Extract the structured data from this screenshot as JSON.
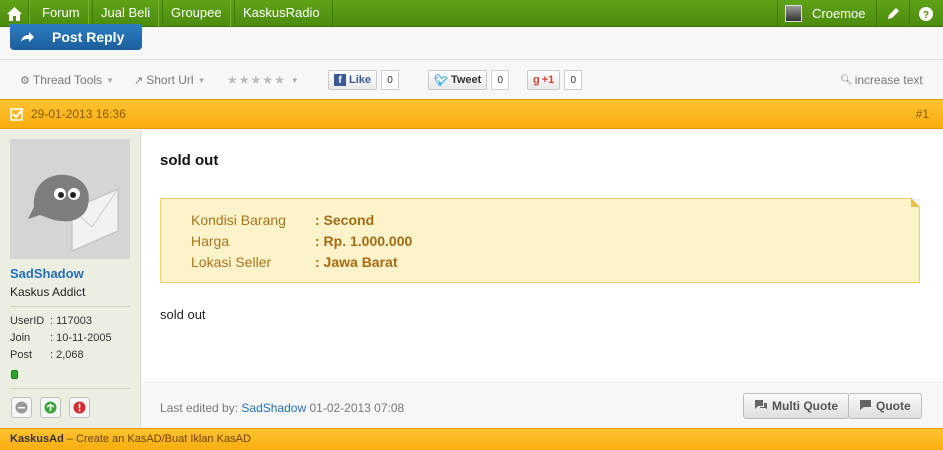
{
  "topnav": {
    "items": [
      "Forum",
      "Jual Beli",
      "Groupee",
      "KaskusRadio"
    ],
    "username": "Croemoe"
  },
  "reply_button": "Post Reply",
  "toolbar": {
    "thread_tools": "Thread Tools",
    "short_url": "Short Url",
    "rating_stars": 5,
    "like_label": "Like",
    "like_count": "0",
    "tweet_label": "Tweet",
    "tweet_count": "0",
    "gplus_label": "+1",
    "gplus_count": "0",
    "increase_text": "increase text"
  },
  "post": {
    "date": "29-01-2013 16:36",
    "number": "#1",
    "title": "sold out",
    "details": [
      {
        "key": "Kondisi Barang",
        "value": ": Second"
      },
      {
        "key": "Harga",
        "value": ": Rp. 1.000.000"
      },
      {
        "key": "Lokasi Seller",
        "value": ": Jawa Barat"
      }
    ],
    "body": "sold out",
    "edited_prefix": "Last edited by:",
    "edited_by": "SadShadow",
    "edited_at": "01-02-2013 07:08",
    "multi_quote": "Multi Quote",
    "quote": "Quote"
  },
  "author": {
    "username": "SadShadow",
    "rank": "Kaskus Addict",
    "fields": [
      {
        "key": "UserID",
        "value": ": 117003"
      },
      {
        "key": "Join",
        "value": ": 10-11-2005"
      },
      {
        "key": "Post",
        "value": ": 2,068"
      }
    ]
  },
  "adbar": {
    "brand": "KaskusAd",
    "text": " – Create an KasAD/Buat Iklan KasAD"
  },
  "colors": {
    "topbar": "#4b8c0e",
    "accent_orange": "#f8ad0f",
    "link_blue": "#2471b5"
  }
}
